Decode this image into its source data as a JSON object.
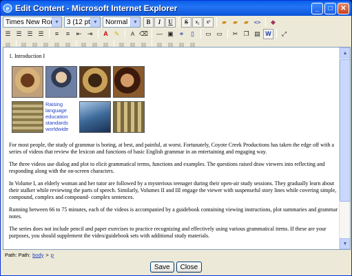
{
  "window": {
    "title": "Edit Content - Microsoft Internet Explorer",
    "minimize": "_",
    "maximize": "□",
    "close": "✕"
  },
  "toolbar": {
    "font_family": "Times New Roman",
    "font_size": "3 (12 pt)",
    "paragraph_style": "Normal",
    "bold": "B",
    "italic": "I",
    "underline": "U",
    "strikethrough": "S",
    "subscript": "x₂",
    "superscript": "x²",
    "source": "<>",
    "word": "W"
  },
  "document": {
    "heading": "1. Introduction I",
    "image_caption": "Raising language education standards worldwide",
    "paragraphs": [
      "For most people, the study of grammar is boring, at best, and painful, at worst.  Fortunately, Coyote Creek Productions has taken the edge off with a series of videos that review the lexicon and functions of basic English grammar in an entertaining and engaging way.",
      "The three videos use dialog and plot to elicit grammatical terms, functions and examples.  The questions raised draw viewers into reflecting and responding along with the on-screen characters.",
      "In Volume I, an elderly woman and her tutor are followed by a mysterious teenager during their open-air study sessions.  They gradually learn about their stalker while reviewing the parts of speech.  Similarly, Volumes II and III engage the viewer with suspenseful story lines while covering simple, compound, complex and compound- complex sentences.",
      "Running between 66 to 75 minutes, each of the videos is accompanied by a guidebook containing viewing instructions, plot summaries and grammar notes.",
      "The series does not include pencil and paper exercises to practice recognizing and effectively using various grammatical items.  If these are your purposes, you should supplement the video/guidebook sets with additional study materials."
    ]
  },
  "status": {
    "label": "Path: Path:",
    "path_body": "body",
    "path_sep": ">",
    "path_p": "p"
  },
  "footer": {
    "save_label": "Save",
    "close_label": "Close"
  }
}
